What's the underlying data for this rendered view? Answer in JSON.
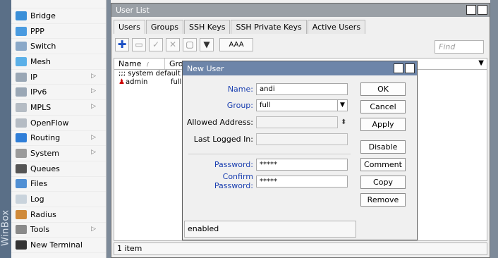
{
  "app": {
    "brand": "WinBox"
  },
  "sidebar": {
    "items": [
      {
        "label": "Bridge",
        "icon": "bridge-icon",
        "color": "#3a8fd8",
        "arrow": false
      },
      {
        "label": "PPP",
        "icon": "ppp-icon",
        "color": "#4a9be0",
        "arrow": false
      },
      {
        "label": "Switch",
        "icon": "switch-icon",
        "color": "#8aa8c8",
        "arrow": false
      },
      {
        "label": "Mesh",
        "icon": "mesh-icon",
        "color": "#5bb0e8",
        "arrow": false
      },
      {
        "label": "IP",
        "icon": "ip-icon",
        "color": "#9aa7b5",
        "arrow": true
      },
      {
        "label": "IPv6",
        "icon": "ipv6-icon",
        "color": "#9aa7b5",
        "arrow": true
      },
      {
        "label": "MPLS",
        "icon": "mpls-icon",
        "color": "#b5bcc4",
        "arrow": true
      },
      {
        "label": "OpenFlow",
        "icon": "openflow-icon",
        "color": "#b5bcc4",
        "arrow": false
      },
      {
        "label": "Routing",
        "icon": "routing-icon",
        "color": "#2f7ed8",
        "arrow": true
      },
      {
        "label": "System",
        "icon": "gear-icon",
        "color": "#9b9b9b",
        "arrow": true
      },
      {
        "label": "Queues",
        "icon": "queues-icon",
        "color": "#555555",
        "arrow": false
      },
      {
        "label": "Files",
        "icon": "folder-icon",
        "color": "#4f8fd4",
        "arrow": false
      },
      {
        "label": "Log",
        "icon": "log-icon",
        "color": "#c9d3dc",
        "arrow": false
      },
      {
        "label": "Radius",
        "icon": "radius-icon",
        "color": "#d08a3a",
        "arrow": false
      },
      {
        "label": "Tools",
        "icon": "tools-icon",
        "color": "#8a8a8a",
        "arrow": true
      },
      {
        "label": "New Terminal",
        "icon": "terminal-icon",
        "color": "#333333",
        "arrow": false
      }
    ]
  },
  "userlist": {
    "title": "User List",
    "tabs": [
      "Users",
      "Groups",
      "SSH Keys",
      "SSH Private Keys",
      "Active Users"
    ],
    "toolbar": {
      "aaa_label": "AAA",
      "find_placeholder": "Find"
    },
    "columns": [
      "Name",
      "Group"
    ],
    "rows": [
      {
        "name": ";;; system default user",
        "group": ""
      },
      {
        "name": "admin",
        "group": "full"
      }
    ],
    "status": "1 item"
  },
  "dialog": {
    "title": "New User",
    "fields": {
      "name": {
        "label": "Name:",
        "value": "andi"
      },
      "group": {
        "label": "Group:",
        "value": "full"
      },
      "allowed_address": {
        "label": "Allowed Address:",
        "value": ""
      },
      "last_logged_in": {
        "label": "Last Logged In:",
        "value": ""
      },
      "password": {
        "label": "Password:",
        "value": "*****"
      },
      "confirm_password": {
        "label": "Confirm Password:",
        "value": "*****"
      }
    },
    "buttons": {
      "ok": "OK",
      "cancel": "Cancel",
      "apply": "Apply",
      "disable": "Disable",
      "comment": "Comment",
      "copy": "Copy",
      "remove": "Remove"
    },
    "status": "enabled"
  }
}
